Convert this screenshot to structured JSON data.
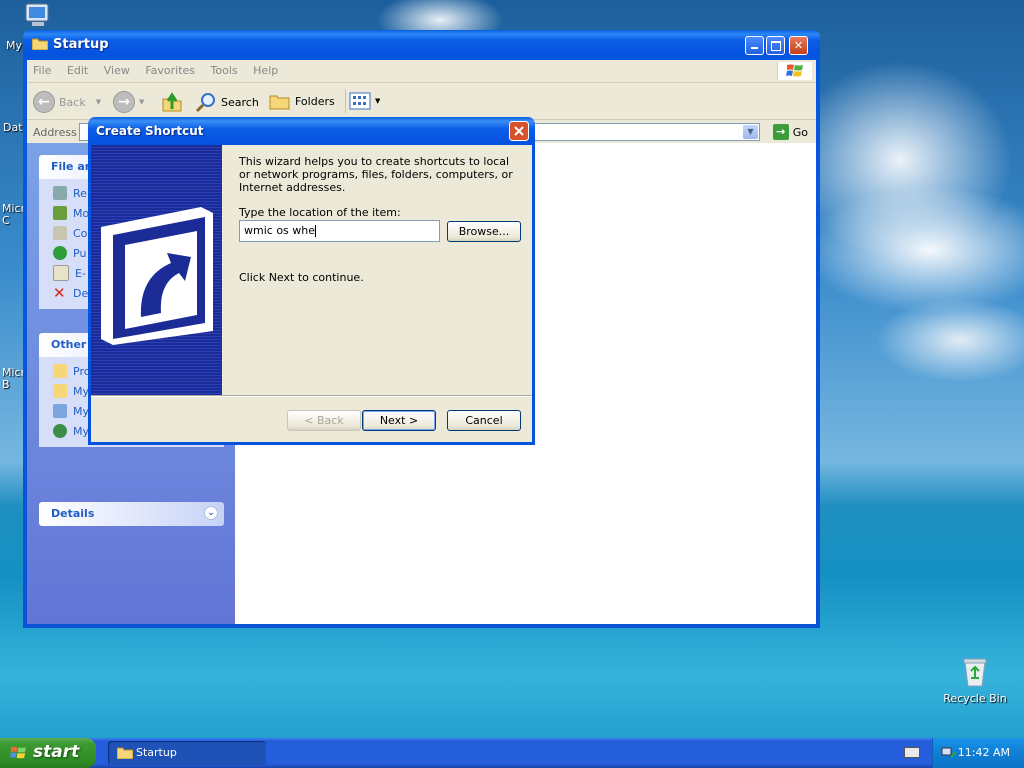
{
  "desktop": {
    "icons": [
      {
        "label": "My"
      },
      {
        "label": "Dat"
      },
      {
        "label": "Micr\nC"
      },
      {
        "label": "Micr\nB"
      }
    ],
    "recycle_bin_label": "Recycle Bin"
  },
  "explorer": {
    "title": "Startup",
    "menu": [
      "File",
      "Edit",
      "View",
      "Favorites",
      "Tools",
      "Help"
    ],
    "toolbar": {
      "back": "Back",
      "search": "Search",
      "folders": "Folders"
    },
    "address_label": "Address",
    "go_label": "Go",
    "taskpane": {
      "file_tasks_title": "File an",
      "file_tasks": [
        "Re",
        "Mo",
        "Co",
        "Pu",
        "E-",
        "De"
      ],
      "other_places_title": "Other",
      "other_places": [
        "Pro",
        "My",
        "My",
        "My"
      ],
      "details_title": "Details"
    }
  },
  "dialog": {
    "title": "Create Shortcut",
    "intro": "This wizard helps you to create shortcuts to local or network programs, files, folders, computers, or Internet addresses.",
    "location_label": "Type the location of the item:",
    "location_value": "wmic os whe",
    "browse": "Browse...",
    "continue_hint": "Click Next to continue.",
    "back": "< Back",
    "next": "Next >",
    "cancel": "Cancel"
  },
  "taskbar": {
    "start": "start",
    "window_button": "Startup",
    "clock": "11:42 AM"
  },
  "colors": {
    "xp_blue": "#0553e0",
    "start_green": "#3c9a32",
    "link_blue": "#215dc6"
  }
}
